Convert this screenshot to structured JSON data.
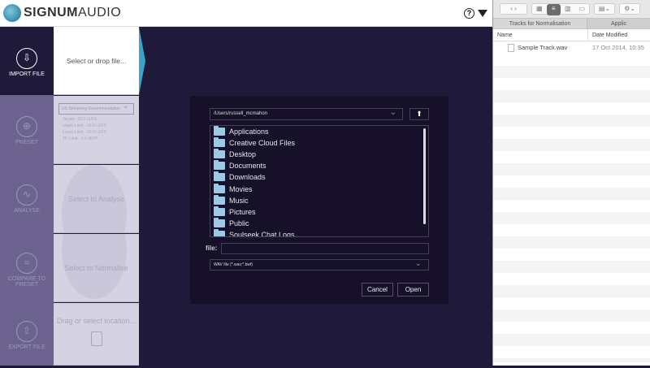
{
  "app": {
    "brand_bold": "SIGNUM",
    "brand_light": "AUDIO",
    "help_icon": "?"
  },
  "sidebar": {
    "items": [
      {
        "label": "IMPORT FILE",
        "icon": "⇩"
      },
      {
        "label": "PRESET",
        "icon": "⊕"
      },
      {
        "label": "ANALYSE",
        "icon": "∿"
      },
      {
        "label": "COMPARE TO PRESET",
        "icon": "≈"
      },
      {
        "label": "EXPORT FILE",
        "icon": "⇧"
      }
    ]
  },
  "cards": {
    "import": "Select or drop file...",
    "preset": {
      "selected": "US Streaming Recommendation",
      "lines": [
        "Target: -16.0 LUFS",
        "Upper Limit: -16.9 LUFS",
        "Lower Limit: -20.0 LUFS",
        "TP Limit: -1.0 dbTP"
      ]
    },
    "analyse": "Select to Analyse",
    "normalise": "Select to Normalise",
    "export": "Drag or select location..."
  },
  "dialog": {
    "path": "/Users/russell_mcmahon",
    "folders": [
      "Applications",
      "Creative Cloud Files",
      "Desktop",
      "Documents",
      "Downloads",
      "Movies",
      "Music",
      "Pictures",
      "Public",
      "Soulseek Chat Logs"
    ],
    "file_label": "file:",
    "file_value": "",
    "filetype": "WAV file (*.wav;*.bwf)",
    "cancel": "Cancel",
    "open": "Open"
  },
  "finder": {
    "tabs": [
      "Tracks for Normalisation",
      "Applic"
    ],
    "columns": {
      "name": "Name",
      "date": "Date Modified"
    },
    "files": [
      {
        "name": "Sample Track.wav",
        "date": "17 Oct 2014, 10:35"
      }
    ]
  }
}
